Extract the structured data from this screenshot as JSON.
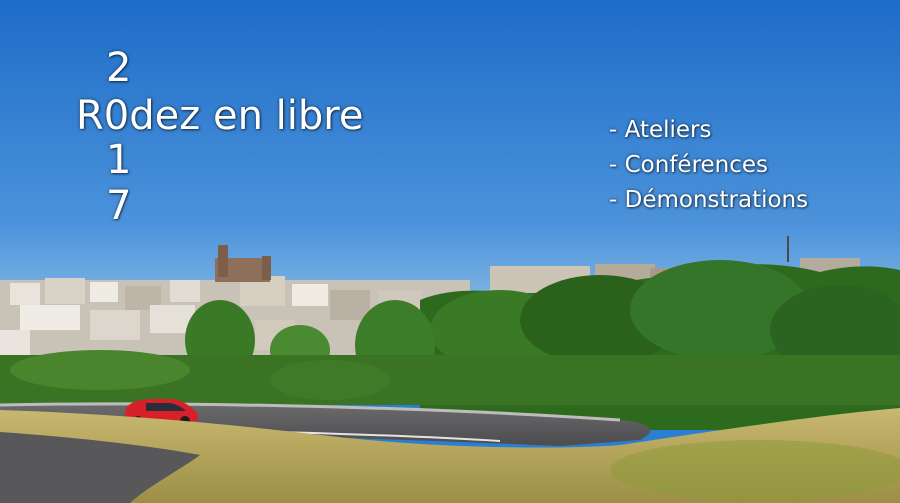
{
  "banner": {
    "digits": [
      "2",
      "1",
      "7"
    ],
    "title": "R0dez en libre",
    "events": [
      "- Ateliers",
      "- Conférences",
      "- Démonstrations"
    ]
  },
  "colors": {
    "sky_top": "#1d6cc8",
    "sky_bottom": "#6aa9de",
    "foliage": "#2f6a1f",
    "grass": "#b8a55a",
    "road": "#5b5b5d",
    "car": "#d8202a"
  }
}
